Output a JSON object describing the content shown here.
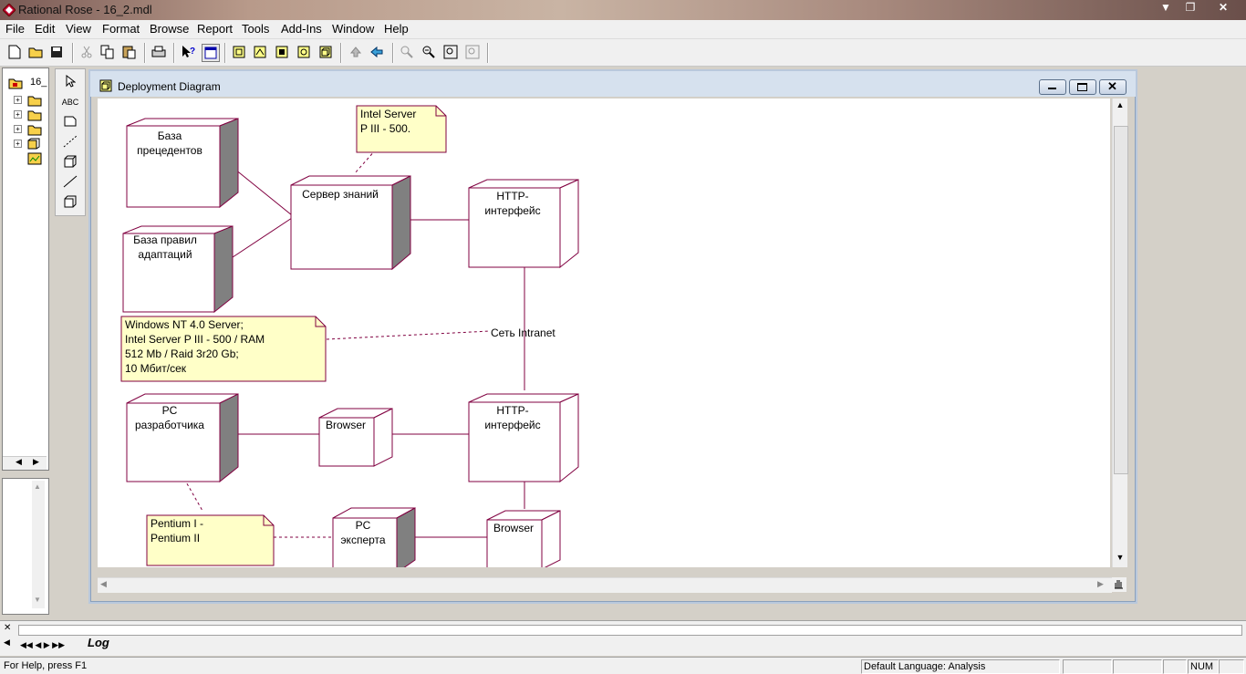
{
  "app": {
    "title": "Rational Rose - 16_2.mdl"
  },
  "menu": [
    "File",
    "Edit",
    "View",
    "Format",
    "Browse",
    "Report",
    "Tools",
    "Add-Ins",
    "Window",
    "Help"
  ],
  "browser": {
    "root_label": "16_"
  },
  "diagram": {
    "window_title": "Deployment Diagram",
    "nodes": {
      "baza_precedentov": "База\nпрецедентов",
      "baza_pravil": "База правил\nадаптаций",
      "server_znaniy": "Сервер знаний",
      "http_top": "HTTP-\nинтерфейс",
      "pc_razrab": "PC\nразработчика",
      "browser_mid": "Browser",
      "http_bottom": "HTTP-\nинтерфейс",
      "pc_expert": "PC\nэксперта",
      "browser_bottom": "Browser"
    },
    "notes": {
      "intel_server": "Intel Server\nP III - 500.",
      "windows_nt": "Windows NT 4.0 Server;\nIntel Server P  III - 500 / RAM\n512 Mb / Raid 3r20 Gb;\n10 Мбит/сек",
      "pentium": "Pentium I -\nPentium II"
    },
    "connection_label": "Сеть Intranet"
  },
  "log": {
    "tab_label": "Log"
  },
  "status": {
    "help": "For Help, press F1",
    "language": "Default Language: Analysis",
    "num": "NUM"
  },
  "colors": {
    "node_border": "#800040",
    "note_fill": "#ffffc8",
    "note_border": "#800040"
  }
}
